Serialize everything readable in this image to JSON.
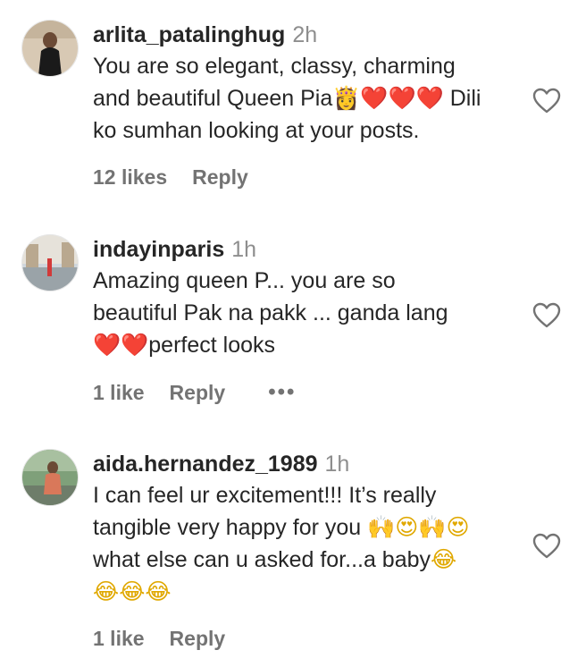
{
  "comments": [
    {
      "username": "arlita_patalinghug",
      "time": "2h",
      "line1": "You are so elegant, classy, charming",
      "line2_text": "and beautiful Queen Pia",
      "line2_emoji": "👸❤️❤️❤️",
      "line2_tail": " Dili",
      "line3": "ko sumhan looking at your posts.",
      "likes": "12 likes",
      "reply": "Reply"
    },
    {
      "username": "indayinparis",
      "time": "1h",
      "line1": "Amazing queen P... you are so",
      "line2": "beautiful Pak na pakk ... ganda lang",
      "line3_emoji": "❤️❤️",
      "line3_text": "perfect looks",
      "likes": "1 like",
      "reply": "Reply",
      "more": "•••"
    },
    {
      "username": "aida.hernandez_1989",
      "time": "1h",
      "line1": "I can feel ur excitement!!! It’s really",
      "line2_text": "tangible very happy for you ",
      "line2_emoji": "🙌😍🙌😍",
      "line3_text": "what else can u asked for...a baby",
      "line3_emoji": "😂",
      "line4_emoji": "😂😂😂",
      "likes": "1 like",
      "reply": "Reply"
    }
  ],
  "icons": {
    "heart": "heart-outline-icon",
    "more": "more-options-icon"
  },
  "colors": {
    "text": "#262626",
    "muted": "#8e8e8e",
    "meta": "#737373"
  }
}
